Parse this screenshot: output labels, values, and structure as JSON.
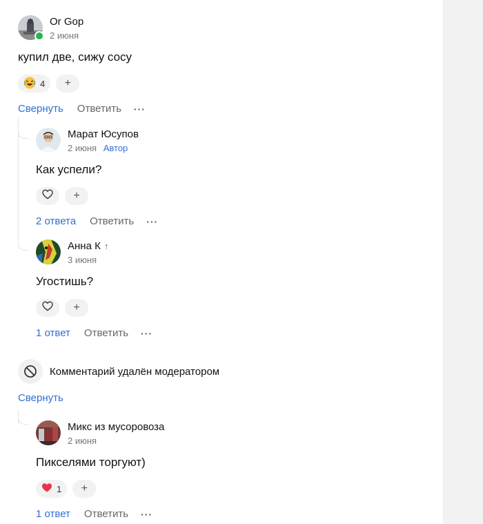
{
  "comments": {
    "c1": {
      "author": "Or Gop",
      "date": "2 июня",
      "text": "купил две, сижу сосу",
      "reaction_count": "4",
      "add": "+",
      "collapse": "Свернуть",
      "reply": "Ответить",
      "more": "···"
    },
    "c2": {
      "author": "Марат Юсупов",
      "date": "2 июня",
      "badge": "Автор",
      "text": "Как успели?",
      "add": "+",
      "replies": "2 ответа",
      "reply": "Ответить",
      "more": "···"
    },
    "c3": {
      "author": "Анна К",
      "arrow": "↑",
      "date": "3 июня",
      "text": "Угостишь?",
      "add": "+",
      "replies": "1 ответ",
      "reply": "Ответить",
      "more": "···"
    },
    "deleted": {
      "text": "Комментарий удалён модератором",
      "collapse": "Свернуть"
    },
    "c4": {
      "author": "Микс из мусоровоза",
      "date": "2 июня",
      "text": "Пикселями торгуют)",
      "reaction_count": "1",
      "add": "+",
      "replies": "1 ответ",
      "reply": "Ответить",
      "more": "···"
    }
  },
  "colors": {
    "link": "#2e6fd6",
    "online": "#27b34a",
    "heart": "#e8334a"
  },
  "icons": [
    "laughing-emoji-icon",
    "heart-outline-icon",
    "heart-filled-icon",
    "plus-icon",
    "more-icon",
    "blocked-icon",
    "arrow-up-icon"
  ]
}
